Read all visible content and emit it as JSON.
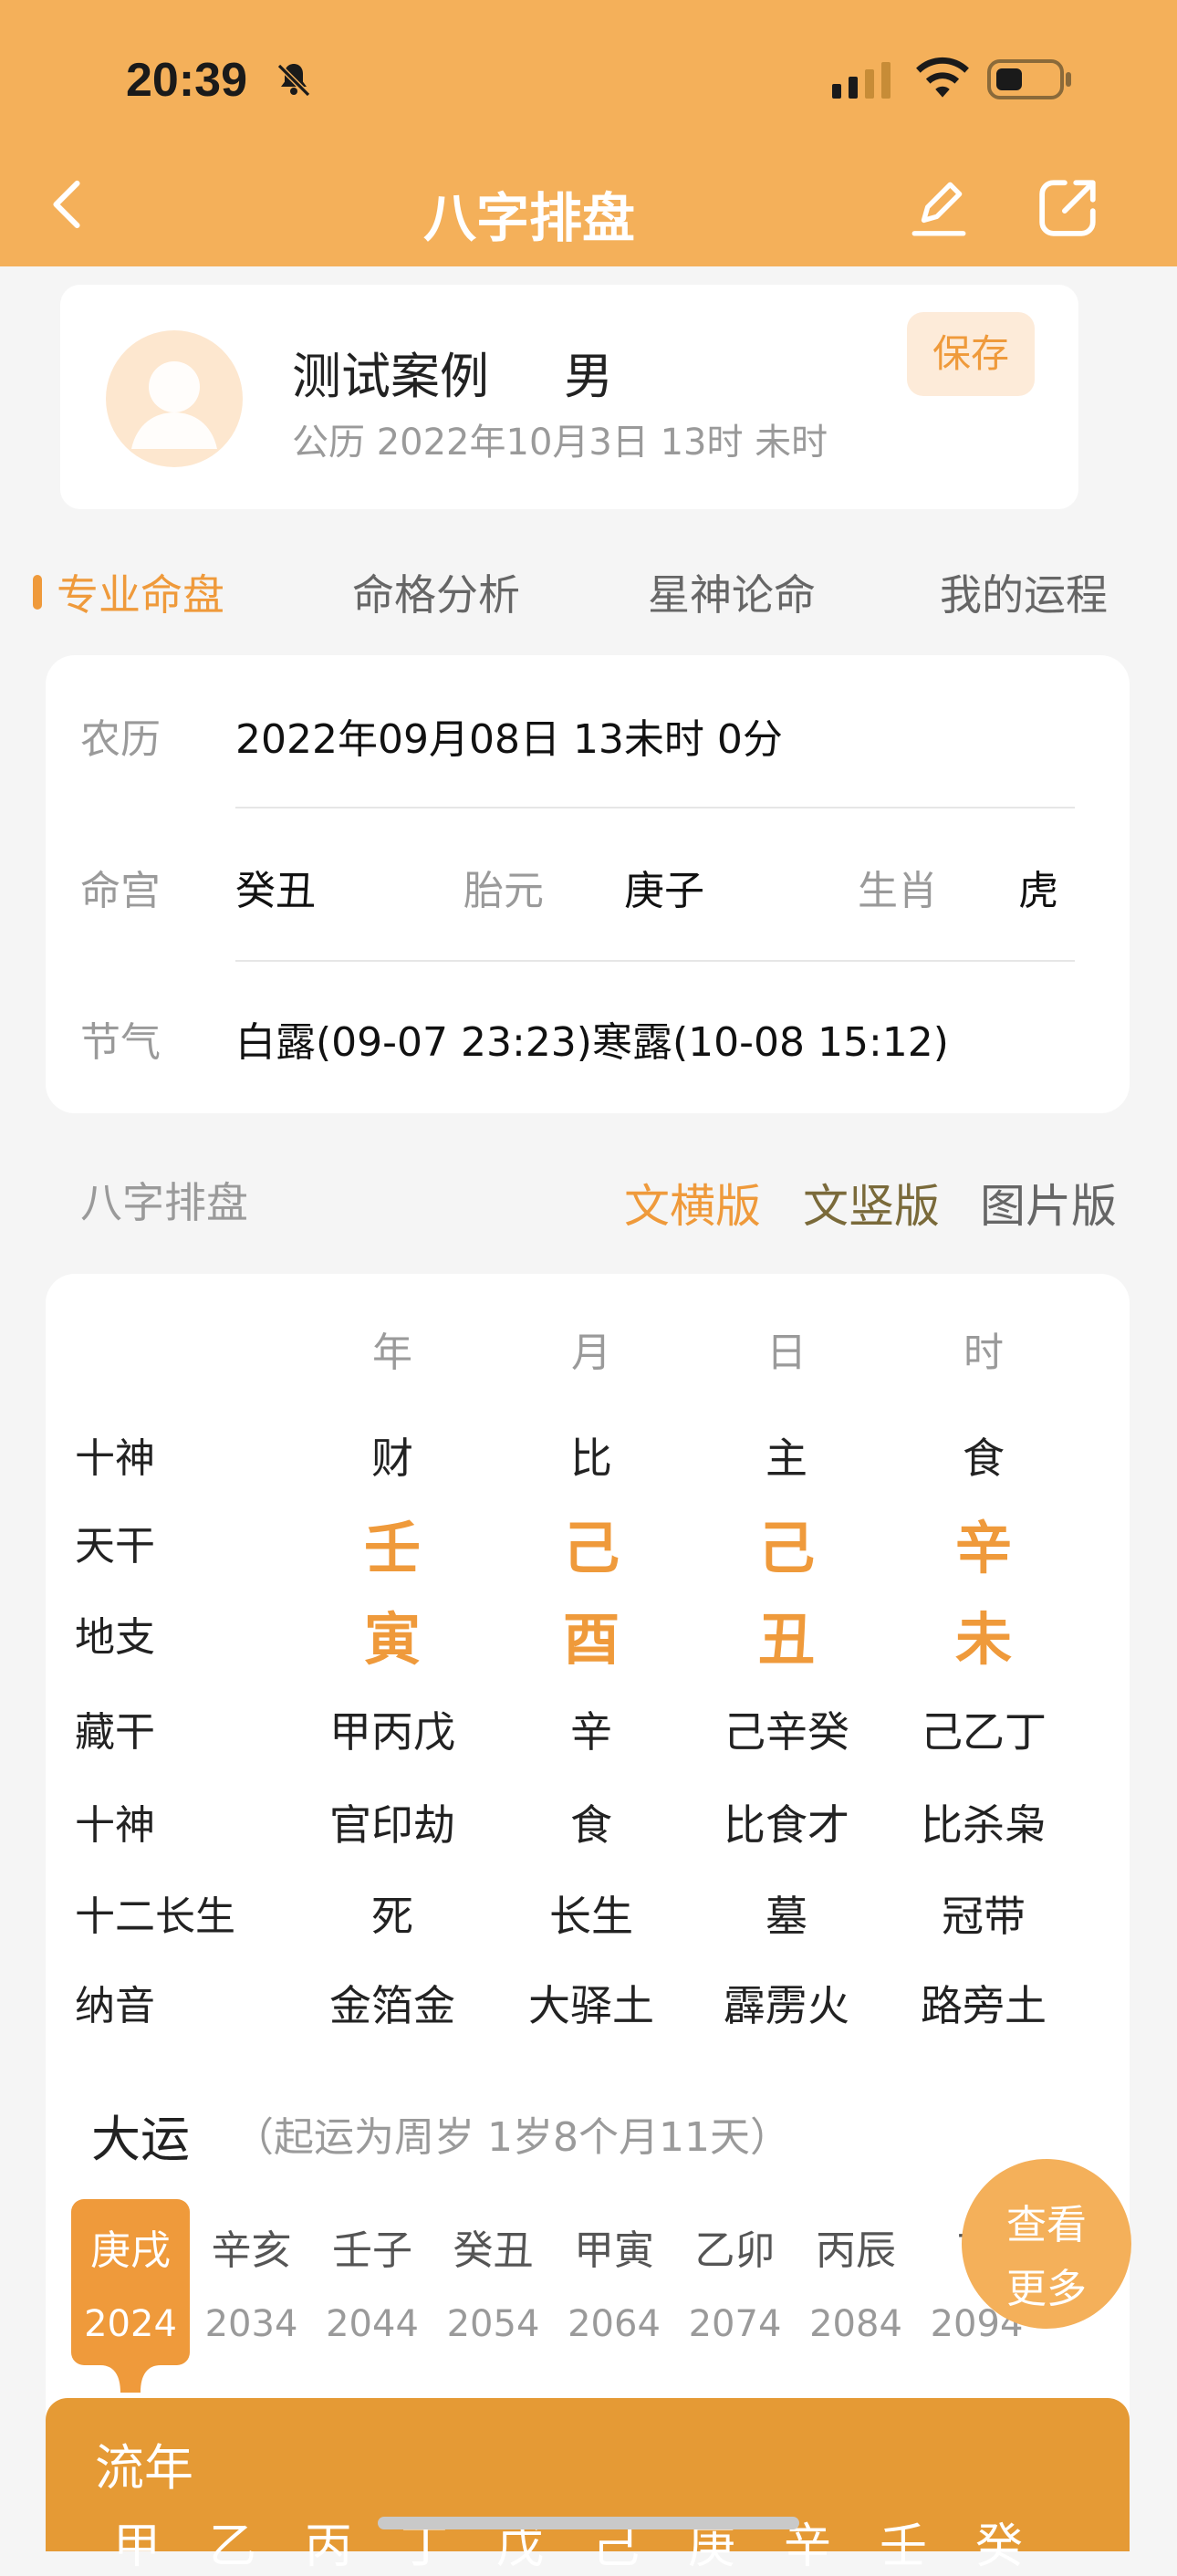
{
  "status_bar": {
    "time": "20:39"
  },
  "nav": {
    "title": "八字排盘"
  },
  "profile": {
    "name": "测试案例",
    "gender": "男",
    "date": "公历 2022年10月3日 13时 未时",
    "save_label": "保存"
  },
  "tabs": [
    {
      "label": "专业命盘",
      "active": true
    },
    {
      "label": "命格分析",
      "active": false
    },
    {
      "label": "星神论命",
      "active": false
    },
    {
      "label": "我的运程",
      "active": false
    }
  ],
  "info": {
    "lunar_label": "农历",
    "lunar_value": "2022年09月08日 13未时 0分",
    "minggong_label": "命宫",
    "minggong_value": "癸丑",
    "taiyuan_label": "胎元",
    "taiyuan_value": "庚子",
    "shengxiao_label": "生肖",
    "shengxiao_value": "虎",
    "jieqi_label": "节气",
    "jieqi_value": "白露(09-07 23:23)寒露(10-08 15:12)"
  },
  "section": {
    "label": "八字排盘",
    "versions": [
      {
        "label": "文横版",
        "color": "#ef9a3b"
      },
      {
        "label": "文竖版",
        "color": "#7a6a3a"
      },
      {
        "label": "图片版",
        "color": "#666666"
      }
    ]
  },
  "bazi": {
    "columns": [
      "年",
      "月",
      "日",
      "时"
    ],
    "rows": [
      {
        "label": "十神",
        "cells": [
          "财",
          "比",
          "主",
          "食"
        ]
      },
      {
        "label": "天干",
        "cells": [
          "壬",
          "己",
          "己",
          "辛"
        ]
      },
      {
        "label": "地支",
        "cells": [
          "寅",
          "酉",
          "丑",
          "未"
        ]
      },
      {
        "label": "藏干",
        "cells": [
          "甲丙戊",
          "辛",
          "己辛癸",
          "己乙丁"
        ]
      },
      {
        "label": "十神",
        "cells": [
          "官印劫",
          "食",
          "比食才",
          "比杀枭"
        ]
      },
      {
        "label": "十二长生",
        "cells": [
          "死",
          "长生",
          "墓",
          "冠带"
        ]
      },
      {
        "label": "纳音",
        "cells": [
          "金箔金",
          "大驿土",
          "霹雳火",
          "路旁土"
        ]
      }
    ]
  },
  "dayun": {
    "title": "大运",
    "note": "（起运为周岁 1岁8个月11天）",
    "items": [
      {
        "gz": "庚戌",
        "year": "2024"
      },
      {
        "gz": "辛亥",
        "year": "2034"
      },
      {
        "gz": "壬子",
        "year": "2044"
      },
      {
        "gz": "癸丑",
        "year": "2054"
      },
      {
        "gz": "甲寅",
        "year": "2064"
      },
      {
        "gz": "乙卯",
        "year": "2074"
      },
      {
        "gz": "丙辰",
        "year": "2084"
      },
      {
        "gz": "丁",
        "year": "2094"
      }
    ],
    "more_line1": "查看",
    "more_line2": "更多"
  },
  "liunian": {
    "title": "流年",
    "chars": [
      "甲",
      "乙",
      "丙",
      "丁",
      "戊",
      "己",
      "庚",
      "辛",
      "壬",
      "癸"
    ]
  },
  "colors": {
    "accent": "#ef9a3b",
    "header": "#f4b05a",
    "liunian": "#e59a35"
  }
}
